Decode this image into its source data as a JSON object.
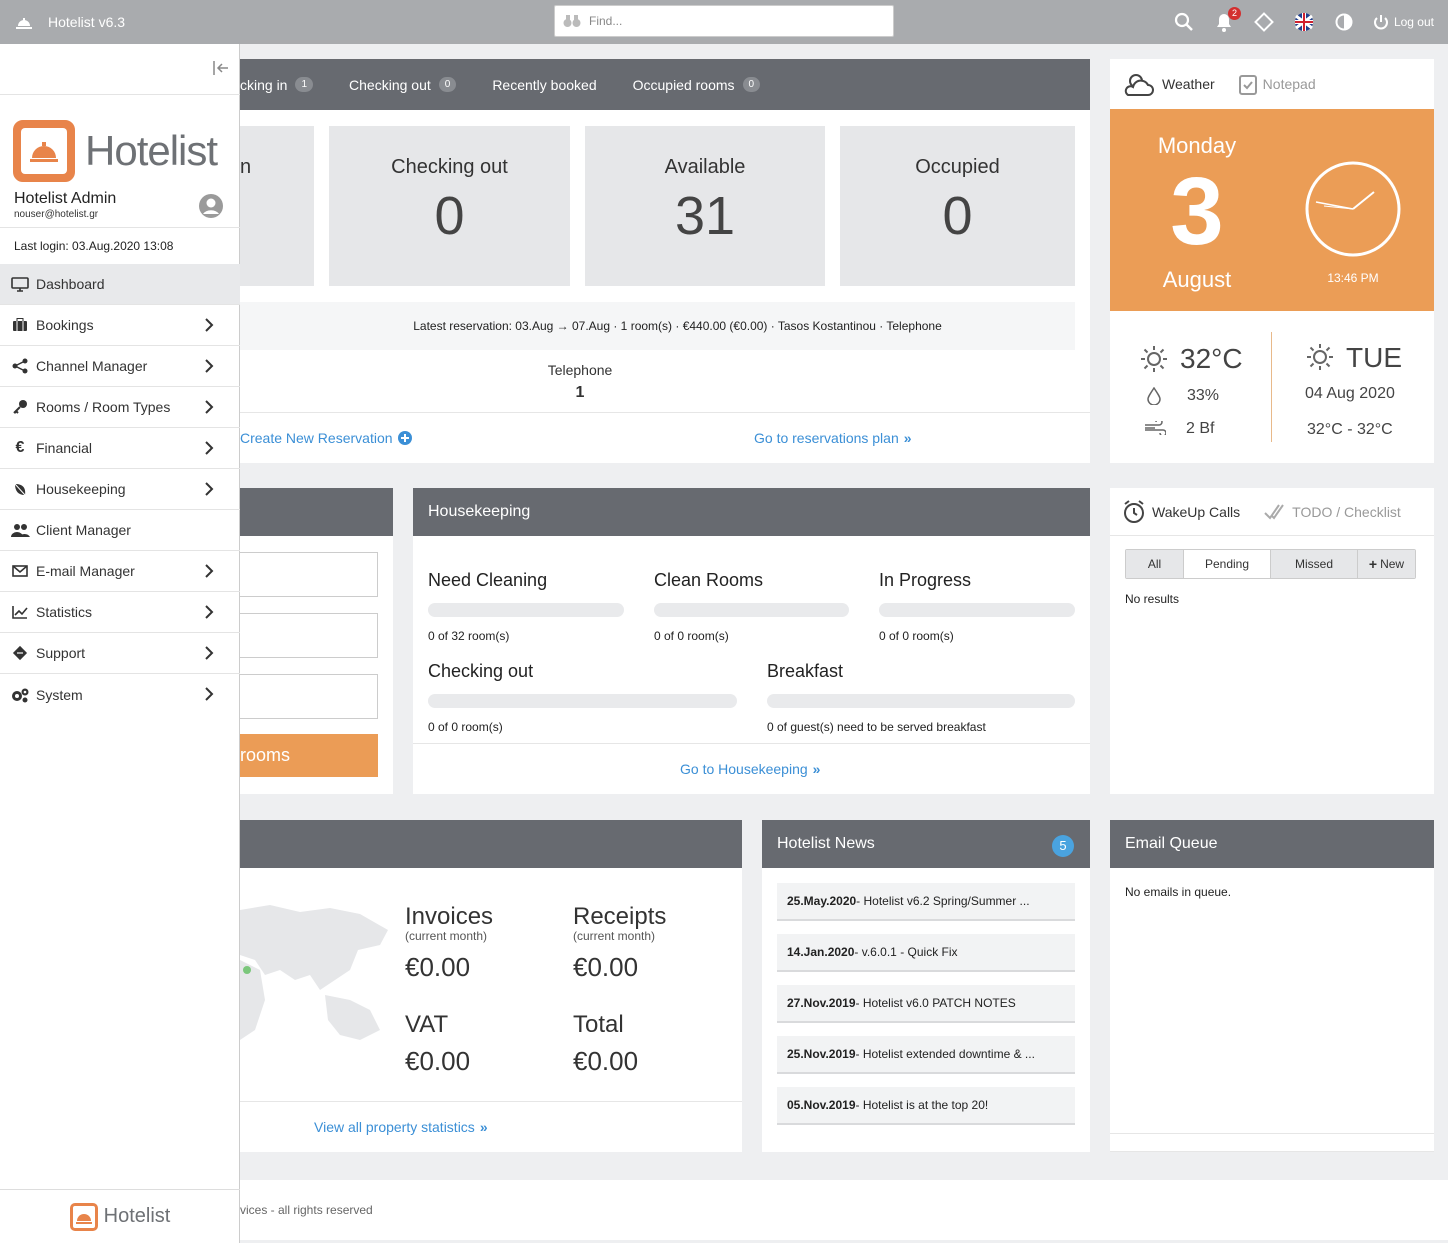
{
  "topbar": {
    "app_title": "Hotelist v6.3",
    "search_placeholder": "Find...",
    "notification_count": "2",
    "logout_label": "Log out"
  },
  "sidebar": {
    "admin_name": "Hotelist Admin",
    "admin_email": "nouser@hotelist.gr",
    "last_login": "Last login: 03.Aug.2020 13:08",
    "logo_text": "Hotelist",
    "items": [
      {
        "label": "Dashboard",
        "icon": "monitor-icon"
      },
      {
        "label": "Bookings",
        "icon": "suitcase-icon"
      },
      {
        "label": "Channel Manager",
        "icon": "share-icon"
      },
      {
        "label": "Rooms / Room Types",
        "icon": "key-icon"
      },
      {
        "label": "Financial",
        "icon": "euro-icon"
      },
      {
        "label": "Housekeeping",
        "icon": "leaf-icon"
      },
      {
        "label": "Client Manager",
        "icon": "users-icon"
      },
      {
        "label": "E-mail Manager",
        "icon": "envelope-icon"
      },
      {
        "label": "Statistics",
        "icon": "chart-icon"
      },
      {
        "label": "Support",
        "icon": "ticket-icon"
      },
      {
        "label": "System",
        "icon": "gears-icon"
      }
    ],
    "footer_logo": "Hotelist"
  },
  "tabs": [
    {
      "label": "cking in",
      "count": "1"
    },
    {
      "label": "Checking out",
      "count": "0"
    },
    {
      "label": "Recently booked",
      "count": ""
    },
    {
      "label": "Occupied rooms",
      "count": "0"
    }
  ],
  "stats": [
    {
      "label": "n",
      "value": ""
    },
    {
      "label": "Checking out",
      "value": "0"
    },
    {
      "label": "Available",
      "value": "31"
    },
    {
      "label": "Occupied",
      "value": "0"
    }
  ],
  "latest_reservation": "Latest reservation: 03.Aug → 07.Aug · 1 room(s) · €440.00 (€0.00) · Tasos Kostantinou · Telephone",
  "telephone": {
    "label": "Telephone",
    "value": "1"
  },
  "links": {
    "create_reservation": "Create New Reservation",
    "reservations_plan": "Go to reservations plan",
    "housekeeping": "Go to Housekeeping",
    "statistics": "View all property statistics"
  },
  "rooms_button": "rooms",
  "housekeeping": {
    "title": "Housekeeping",
    "items": [
      {
        "title": "Need Cleaning",
        "sub": "0 of 32 room(s)",
        "progress": 0
      },
      {
        "title": "Clean Rooms",
        "sub": "0 of 0 room(s)",
        "progress": 0
      },
      {
        "title": "In Progress",
        "sub": "0 of 0 room(s)",
        "progress": 0
      },
      {
        "title": "Checking out",
        "sub": "0 of 0 room(s)",
        "progress": 0
      },
      {
        "title": "Breakfast",
        "sub": "0 of guest(s) need to be served breakfast",
        "progress": 0
      }
    ]
  },
  "weather": {
    "tab_weather": "Weather",
    "tab_notepad": "Notepad",
    "day": "Monday",
    "date_num": "3",
    "month": "August",
    "time": "13:46 PM",
    "temp": "32°C",
    "humidity": "33%",
    "wind": "2 Bf",
    "next_day": "TUE",
    "next_date": "04 Aug 2020",
    "next_range": "32°C - 32°C",
    "accent": "#eb9d56"
  },
  "wakeup": {
    "tab_wakeup": "WakeUp Calls",
    "tab_todo": "TODO / Checklist",
    "filters": [
      "All",
      "Pending",
      "Missed"
    ],
    "new_label": "New",
    "empty": "No results"
  },
  "financial": {
    "invoices": "Invoices",
    "receipts": "Receipts",
    "current_month": "(current month)",
    "vat": "VAT",
    "total": "Total",
    "invoices_val": "€0.00",
    "receipts_val": "€0.00",
    "vat_val": "€0.00",
    "total_val": "€0.00"
  },
  "news": {
    "title": "Hotelist News",
    "count": "5",
    "items": [
      {
        "date": "25.May.2020",
        "text": " - Hotelist v6.2 Spring/Summer ..."
      },
      {
        "date": "14.Jan.2020",
        "text": " - v.6.0.1 - Quick Fix"
      },
      {
        "date": "27.Nov.2019",
        "text": " - Hotelist v6.0 PATCH NOTES"
      },
      {
        "date": "25.Nov.2019",
        "text": " - Hotelist extended downtime & ..."
      },
      {
        "date": "05.Nov.2019",
        "text": " - Hotelist is at the top 20!"
      }
    ]
  },
  "email_queue": {
    "title": "Email Queue",
    "empty": "No emails in queue."
  },
  "footer": "vices - all rights reserved"
}
